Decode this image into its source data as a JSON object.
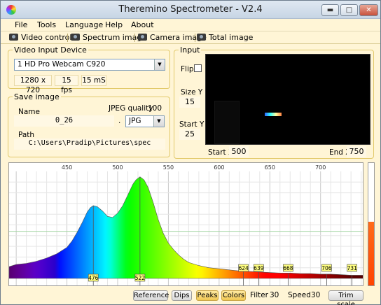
{
  "window": {
    "title": "Theremino Spectrometer - V2.4"
  },
  "menu": [
    "File",
    "Tools",
    "Language",
    "Help",
    "About"
  ],
  "toolbar": {
    "video_controls": "Video controls",
    "spectrum_image": "Spectrum image",
    "camera_image": "Camera image",
    "total_image": "Total image"
  },
  "video_input": {
    "title": "Video Input Device",
    "device": "1 HD Pro Webcam C920",
    "resolution": "1280 x 720",
    "fps": "15 fps",
    "exposure": "15 mS"
  },
  "save_image": {
    "title": "Save image",
    "name_label": "Name",
    "name_value": "0_26",
    "jpeg_quality_label": "JPEG quality",
    "jpeg_quality_value": "100",
    "dot": ".",
    "format": "JPG",
    "path_label": "Path",
    "path_value": "C:\\Users\\Pradip\\Pictures\\spec"
  },
  "input": {
    "title": "Input",
    "flip_label": "Flip",
    "size_y_label": "Size Y",
    "size_y_value": "15",
    "start_y_label": "Start Y",
    "start_y_value": "25",
    "start_x_label": "Start X",
    "start_x_value": "500",
    "end_x_label": "End X",
    "end_x_value": "750"
  },
  "chart_data": {
    "type": "area",
    "xlabel": "",
    "ylabel": "",
    "xlim": [
      393,
      743
    ],
    "ticks": [
      450,
      500,
      550,
      600,
      650,
      700
    ],
    "tick_labels": [
      "450",
      "500",
      "550",
      "600",
      "650",
      "700"
    ],
    "x": [
      393,
      400,
      410,
      420,
      430,
      440,
      450,
      455,
      460,
      465,
      470,
      473,
      476,
      480,
      485,
      490,
      495,
      500,
      505,
      510,
      515,
      518,
      522,
      526,
      530,
      535,
      540,
      545,
      550,
      555,
      560,
      565,
      570,
      580,
      590,
      600,
      610,
      620,
      630,
      640,
      650,
      660,
      670,
      680,
      690,
      700,
      710,
      720,
      730,
      743
    ],
    "values": [
      0.11,
      0.13,
      0.14,
      0.16,
      0.19,
      0.23,
      0.29,
      0.35,
      0.43,
      0.52,
      0.62,
      0.66,
      0.68,
      0.67,
      0.63,
      0.58,
      0.57,
      0.61,
      0.68,
      0.78,
      0.88,
      0.92,
      0.95,
      0.92,
      0.85,
      0.71,
      0.55,
      0.42,
      0.33,
      0.27,
      0.22,
      0.18,
      0.15,
      0.12,
      0.1,
      0.09,
      0.08,
      0.07,
      0.065,
      0.06,
      0.055,
      0.05,
      0.05,
      0.045,
      0.045,
      0.04,
      0.04,
      0.035,
      0.03,
      0.03
    ],
    "ylim": [
      0,
      1
    ],
    "peaks": [
      {
        "x": 476,
        "label": "476"
      },
      {
        "x": 522,
        "label": "522"
      },
      {
        "x": 624,
        "label": "624"
      },
      {
        "x": 639,
        "label": "639"
      },
      {
        "x": 668,
        "label": "668"
      },
      {
        "x": 706,
        "label": "706"
      },
      {
        "x": 731,
        "label": "731"
      }
    ],
    "grid": true
  },
  "bottom": {
    "reference": "Reference",
    "dips": "Dips",
    "peaks": "Peaks",
    "colors": "Colors",
    "filter_label": "Filter",
    "filter_value": "30",
    "speed_label": "Speed",
    "speed_value": "30",
    "trim_scale": "Trim scale"
  },
  "colors": {
    "panel_bg": "#fff5d6",
    "group_border": "#e2c96a",
    "peak_marker": "#ffff80"
  }
}
